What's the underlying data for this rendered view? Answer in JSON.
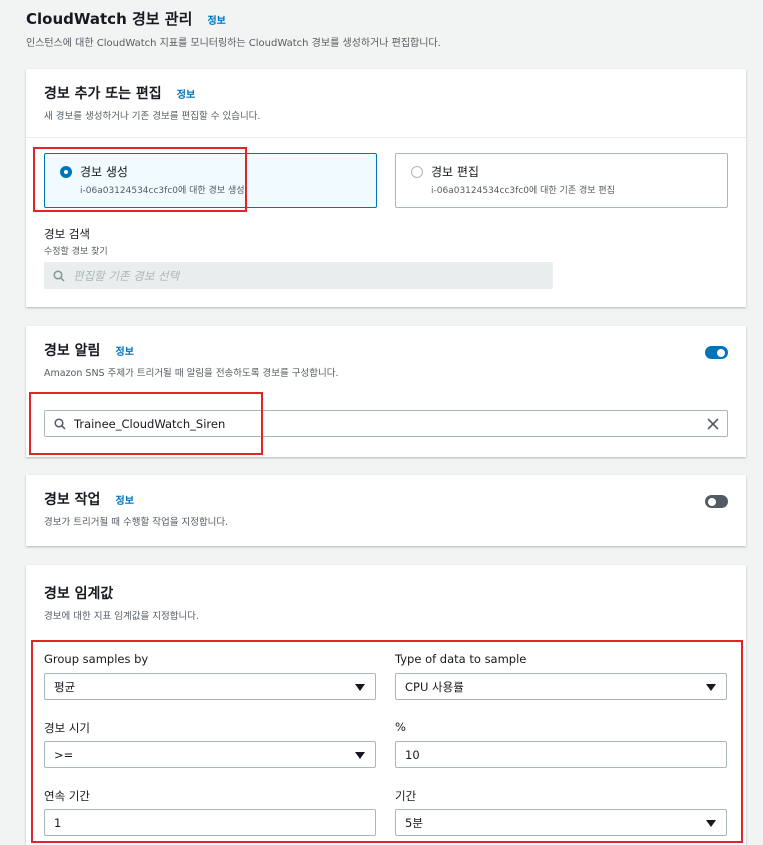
{
  "page": {
    "title": "CloudWatch 경보 관리",
    "info": "정보",
    "description": "인스턴스에 대한 CloudWatch 지표를 모니터링하는 CloudWatch 경보를 생성하거나 편집합니다."
  },
  "add_edit": {
    "title": "경보 추가 또는 편집",
    "info": "정보",
    "description": "새 경보를 생성하거나 기존 경보를 편집할 수 있습니다.",
    "options": [
      {
        "label": "경보 생성",
        "sub": "i-06a03124534cc3fc0에 대한 경보 생성",
        "selected": true
      },
      {
        "label": "경보 편집",
        "sub": "i-06a03124534cc3fc0에 대한 기존 경보 편집",
        "selected": false
      }
    ],
    "search": {
      "label": "경보 검색",
      "sub": "수정할 경보 찾기",
      "placeholder": "편집할 기존 경보 선택"
    }
  },
  "notification": {
    "title": "경보 알림",
    "info": "정보",
    "description": "Amazon SNS 주제가 트리거될 때 알림을 전송하도록 경보를 구성합니다.",
    "enabled": true,
    "topic": "Trainee_CloudWatch_Siren"
  },
  "action": {
    "title": "경보 작업",
    "info": "정보",
    "description": "경보가 트리거될 때 수행할 작업을 지정합니다.",
    "enabled": false
  },
  "threshold": {
    "title": "경보 임계값",
    "description": "경보에 대한 지표 임계값을 지정합니다.",
    "group_by": {
      "label": "Group samples by",
      "value": "평균"
    },
    "data_type": {
      "label": "Type of data to sample",
      "value": "CPU 사용률"
    },
    "when": {
      "label": "경보 시기",
      "value": ">="
    },
    "percent": {
      "label": "%",
      "value": "10"
    },
    "consecutive": {
      "label": "연속 기간",
      "value": "1"
    },
    "period": {
      "label": "기간",
      "value": "5분"
    }
  },
  "colors": {
    "accent": "#0073bb",
    "highlight": "#e0242a",
    "background": "#f2f3f3"
  }
}
